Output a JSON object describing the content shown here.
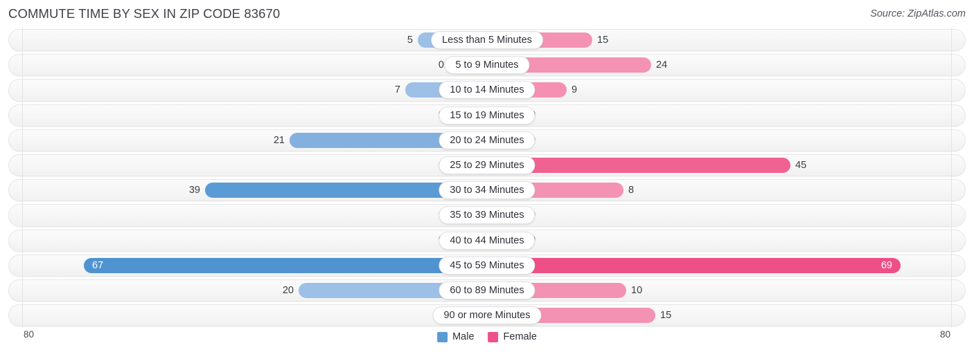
{
  "header": {
    "title": "COMMUTE TIME BY SEX IN ZIP CODE 83670",
    "source": "Source: ZipAtlas.com"
  },
  "legend": {
    "male_label": "Male",
    "female_label": "Female",
    "male_color": "#5B9BD5",
    "female_color": "#EE5189"
  },
  "axis": {
    "left_max": "80",
    "right_max": "80"
  },
  "chart_data": {
    "type": "bar",
    "title": "COMMUTE TIME BY SEX IN ZIP CODE 83670",
    "subtitle": "Source: ZipAtlas.com",
    "orientation": "horizontal-diverging",
    "xlabel": "",
    "ylabel": "",
    "xlim": [
      0,
      80
    ],
    "grid": false,
    "legend_position": "bottom-center",
    "categories": [
      "Less than 5 Minutes",
      "5 to 9 Minutes",
      "10 to 14 Minutes",
      "15 to 19 Minutes",
      "20 to 24 Minutes",
      "25 to 29 Minutes",
      "30 to 34 Minutes",
      "35 to 39 Minutes",
      "40 to 44 Minutes",
      "45 to 59 Minutes",
      "60 to 89 Minutes",
      "90 or more Minutes"
    ],
    "series": [
      {
        "name": "Male",
        "color": "#5B9BD5",
        "side": "left",
        "values": [
          5,
          0,
          7,
          0,
          21,
          0,
          39,
          0,
          0,
          67,
          20,
          0
        ]
      },
      {
        "name": "Female",
        "color": "#EE5189",
        "side": "right",
        "values": [
          15,
          24,
          9,
          0,
          0,
          45,
          8,
          0,
          0,
          69,
          10,
          15
        ]
      }
    ]
  },
  "rows": [
    {
      "label": "Less than 5 Minutes",
      "male": "5",
      "female": "15",
      "male_w": 100,
      "female_w": 152,
      "male_tone": "mid",
      "female_tone": "",
      "male_inside": false,
      "female_inside": false
    },
    {
      "label": "5 to 9 Minutes",
      "male": "0",
      "female": "24",
      "male_w": 55,
      "female_w": 237,
      "male_tone": "pale",
      "female_tone": "",
      "male_inside": false,
      "female_inside": false
    },
    {
      "label": "10 to 14 Minutes",
      "male": "7",
      "female": "9",
      "male_w": 118,
      "female_w": 115,
      "male_tone": "mid",
      "female_tone": "mid",
      "male_inside": false,
      "female_inside": false
    },
    {
      "label": "15 to 19 Minutes",
      "male": "0",
      "female": "0",
      "male_w": 55,
      "female_w": 55,
      "male_tone": "pale",
      "female_tone": "pale",
      "male_inside": false,
      "female_inside": false
    },
    {
      "label": "20 to 24 Minutes",
      "male": "21",
      "female": "0",
      "male_w": 285,
      "female_w": 55,
      "male_tone": "",
      "female_tone": "pale",
      "male_inside": false,
      "female_inside": false
    },
    {
      "label": "25 to 29 Minutes",
      "male": "0",
      "female": "45",
      "male_w": 55,
      "female_w": 438,
      "male_tone": "pale",
      "female_tone": "strong",
      "male_inside": false,
      "female_inside": false
    },
    {
      "label": "30 to 34 Minutes",
      "male": "39",
      "female": "8",
      "male_w": 407,
      "female_w": 197,
      "male_tone": "strong",
      "female_tone": "",
      "male_inside": false,
      "female_inside": false
    },
    {
      "label": "35 to 39 Minutes",
      "male": "0",
      "female": "0",
      "male_w": 55,
      "female_w": 55,
      "male_tone": "pale",
      "female_tone": "pale",
      "male_inside": false,
      "female_inside": false
    },
    {
      "label": "40 to 44 Minutes",
      "male": "0",
      "female": "0",
      "male_w": 55,
      "female_w": 55,
      "male_tone": "pale",
      "female_tone": "pale",
      "male_inside": false,
      "female_inside": false
    },
    {
      "label": "45 to 59 Minutes",
      "male": "67",
      "female": "69",
      "male_w": 582,
      "female_w": 597,
      "male_tone": "vivid",
      "female_tone": "vivid",
      "male_inside": true,
      "female_inside": true
    },
    {
      "label": "60 to 89 Minutes",
      "male": "20",
      "female": "10",
      "male_w": 272,
      "female_w": 201,
      "male_tone": "mid",
      "female_tone": "",
      "male_inside": false,
      "female_inside": false
    },
    {
      "label": "90 or more Minutes",
      "male": "0",
      "female": "15",
      "male_w": 55,
      "female_w": 243,
      "male_tone": "pale",
      "female_tone": "",
      "male_inside": false,
      "female_inside": false
    }
  ]
}
